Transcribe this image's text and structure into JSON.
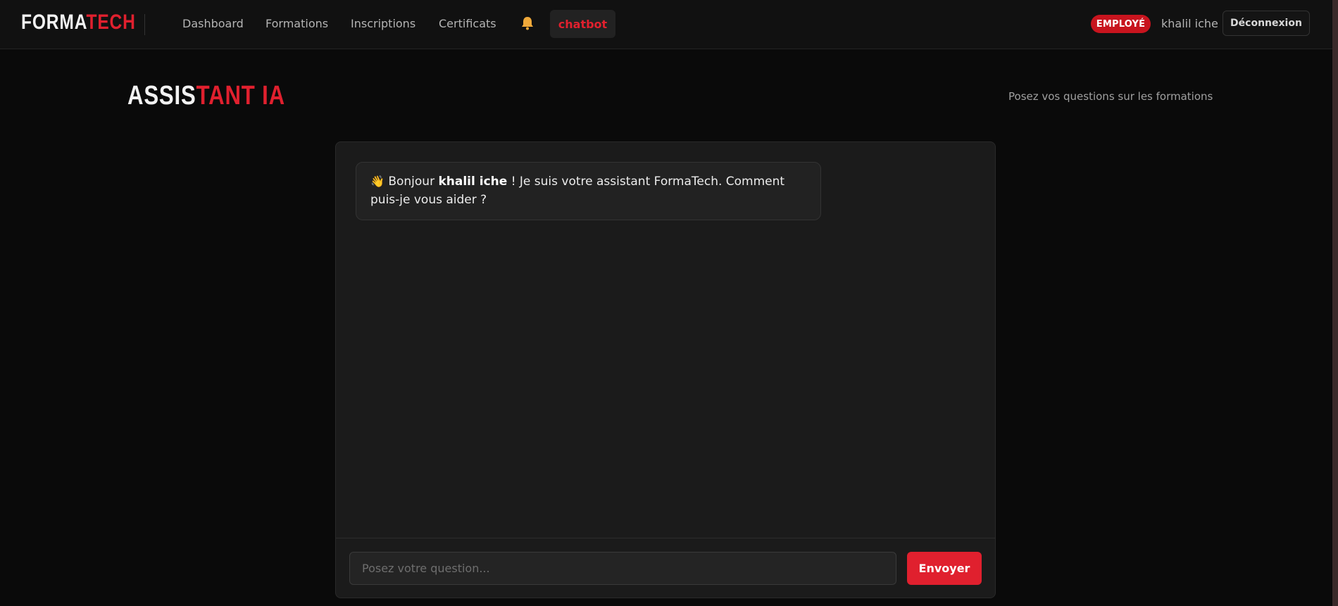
{
  "nav": {
    "brand_white": "FORMA",
    "brand_red": "TECH",
    "items": [
      {
        "label": "Dashboard"
      },
      {
        "label": "Formations"
      },
      {
        "label": "Inscriptions"
      },
      {
        "label": "Certificats"
      }
    ],
    "notifications_icon": "bell-icon",
    "active_item": "chatbot",
    "role_badge": "EMPLOYÉ",
    "username": "khalil iche",
    "logout_label": "Déconnexion"
  },
  "page": {
    "title_white": "ASSIS",
    "title_red": "TANT IA",
    "subtitle": "Posez vos questions sur les formations"
  },
  "chat": {
    "messages": [
      {
        "sender": "assistant",
        "icon": "waving-hand-icon",
        "prefix": "Bonjour ",
        "name": "khalil iche",
        "suffix": " ! Je suis votre assistant FormaTech. Comment puis-je vous aider ?"
      }
    ],
    "input_placeholder": "Posez votre question...",
    "input_value": "",
    "send_label": "Envoyer"
  },
  "colors": {
    "accent": "#e0202e",
    "background": "#0a0a0a",
    "panel": "#1b1b1b"
  }
}
